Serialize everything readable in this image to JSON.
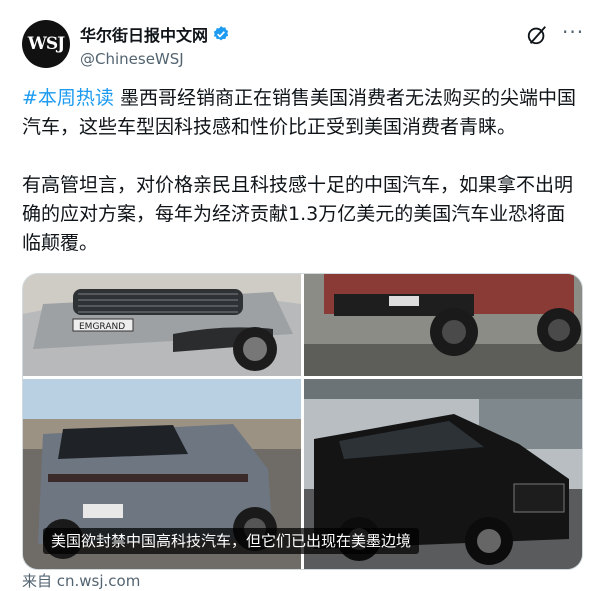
{
  "author": {
    "display_name": "华尔街日报中文网",
    "handle": "@ChineseWSJ",
    "avatar_text": "WSJ"
  },
  "post": {
    "hashtag": "#本周热读",
    "text1": " 墨西哥经销商正在销售美国消费者无法购买的尖端中国汽车，这些车型因科技感和性价比正受到美国消费者青睐。",
    "text2": "有高管坦言，对价格亲民且科技感十足的中国汽车，如果拿不出明确的应对方案，每年为经济贡献1.3万亿美元的美国汽车业恐将面临颠覆。"
  },
  "media": {
    "caption": "美国欲封禁中国高科技汽车，但它们已出现在美墨边境",
    "front_plate_text": "EMGRAND"
  },
  "source": "来自 cn.wsj.com",
  "colors": {
    "accent": "#1d9bf0",
    "text": "#0f1419",
    "muted": "#536471"
  },
  "icons": [
    "verified-badge-icon",
    "grok-icon",
    "more-icon"
  ]
}
